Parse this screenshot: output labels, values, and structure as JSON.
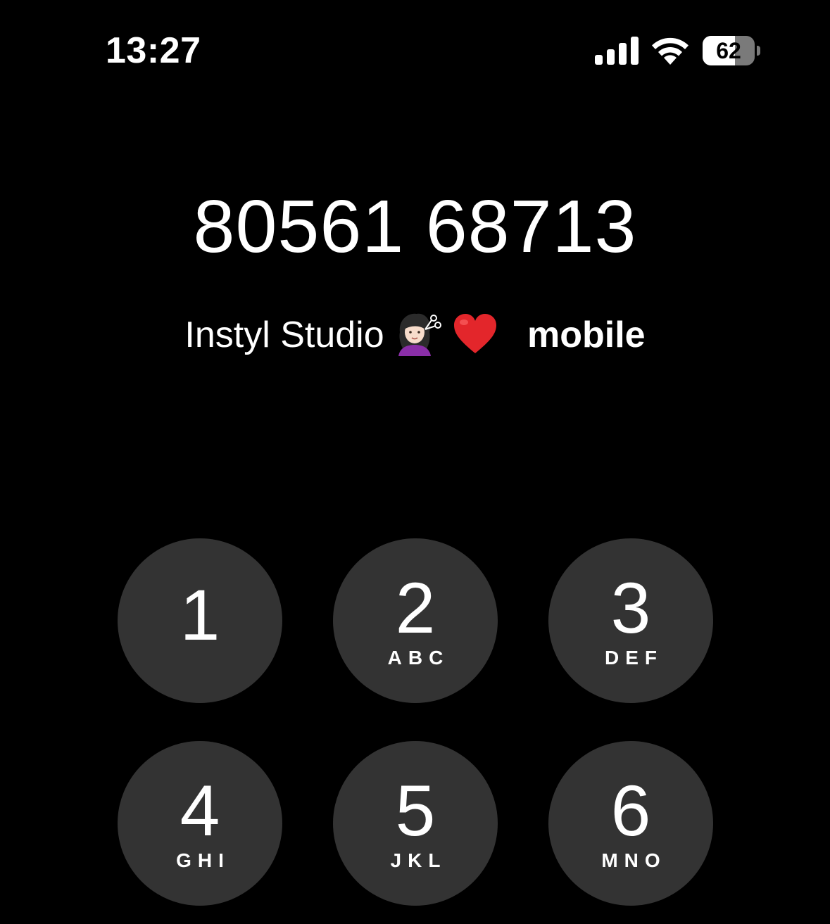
{
  "status_bar": {
    "time": "13:27",
    "signal_icon": "cellular-signal-icon",
    "wifi_icon": "wifi-icon",
    "battery_level": 62,
    "battery_text": "62"
  },
  "dialer": {
    "number": "80561 68713",
    "contact_name": "Instyl Studio",
    "contact_emojis": [
      "woman-getting-haircut-emoji",
      "red-heart-emoji"
    ],
    "contact_label": "mobile"
  },
  "keypad": {
    "keys": [
      {
        "digit": "1",
        "letters": ""
      },
      {
        "digit": "2",
        "letters": "ABC"
      },
      {
        "digit": "3",
        "letters": "DEF"
      },
      {
        "digit": "4",
        "letters": "GHI"
      },
      {
        "digit": "5",
        "letters": "JKL"
      },
      {
        "digit": "6",
        "letters": "MNO"
      }
    ]
  },
  "colors": {
    "background": "#000000",
    "key_background": "#333333",
    "text": "#ffffff"
  }
}
